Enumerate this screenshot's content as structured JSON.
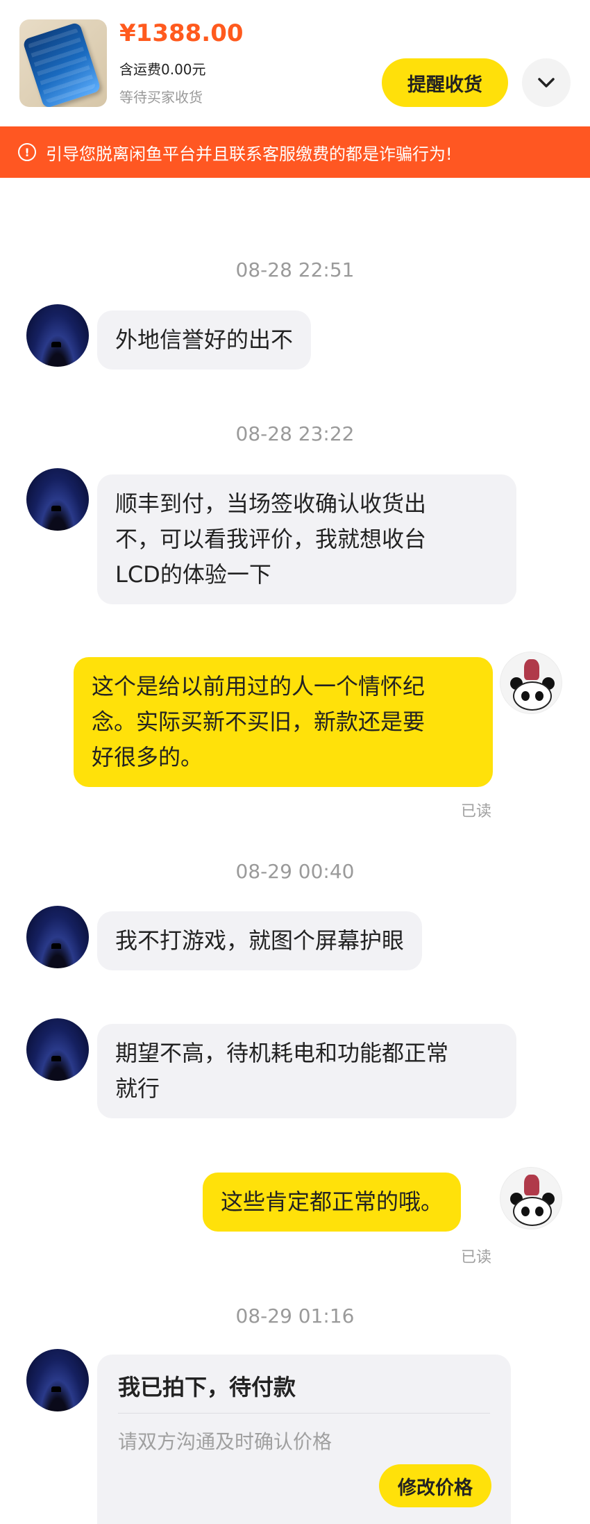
{
  "header": {
    "price": "¥1388.00",
    "shipping": "含运费0.00元",
    "status": "等待买家收货",
    "remind_button": "提醒收货",
    "more_icon": "chevron-down-icon"
  },
  "warning": {
    "icon": "alert-circle-icon",
    "icon_glyph": "!",
    "text": "引导您脱离闲鱼平台并且联系客服缴费的都是诈骗行为!"
  },
  "chat": {
    "timestamps": [
      "08-28 22:51",
      "08-28 23:22",
      "08-29 00:40",
      "08-29 01:16"
    ],
    "messages": [
      {
        "side": "left",
        "text": "外地信誉好的出不"
      },
      {
        "side": "left",
        "lines": [
          "顺丰到付，当场签收确认收货出",
          "不，可以看我评价，我就想收台",
          "LCD的体验一下"
        ]
      },
      {
        "side": "right",
        "lines": [
          "这个是给以前用过的人一个情怀纪",
          "念。实际买新不买旧，新款还是要",
          "好很多的。"
        ],
        "status": "已读"
      },
      {
        "side": "left",
        "text": "我不打游戏，就图个屏幕护眼"
      },
      {
        "side": "left",
        "lines": [
          "期望不高，待机耗电和功能都正常",
          "就行"
        ]
      },
      {
        "side": "right",
        "text": "这些肯定都正常的哦。",
        "status": "已读"
      }
    ],
    "order_card": {
      "title": "我已拍下，待付款",
      "subtitle": "请双方沟通及时确认价格",
      "button": "修改价格"
    }
  },
  "colors": {
    "accent_yellow": "#ffe10a",
    "price_orange": "#ff5a1e",
    "warning_bg": "#ff5722",
    "bubble_gray": "#f2f2f5"
  }
}
